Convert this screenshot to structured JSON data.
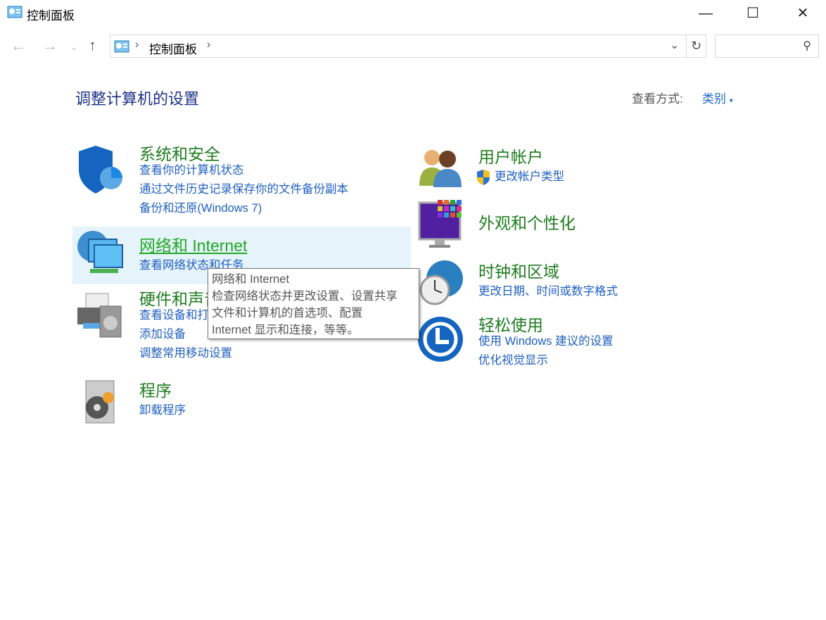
{
  "window": {
    "title": "控制面板"
  },
  "address": {
    "breadcrumb": "控制面板",
    "search_placeholder": ""
  },
  "header": {
    "title": "调整计算机的设置",
    "view_by_label": "查看方式:",
    "view_by_value": "类别"
  },
  "categories": [
    {
      "title": "系统和安全",
      "links": [
        "查看你的计算机状态",
        "通过文件历史记录保存你的文件备份副本",
        "备份和还原(Windows 7)"
      ]
    },
    {
      "title": "网络和 Internet",
      "links": [
        "查看网络状态和任务"
      ]
    },
    {
      "title": "硬件和声音",
      "links": [
        "查看设备和打印机",
        "添加设备",
        "调整常用移动设置"
      ]
    },
    {
      "title": "程序",
      "links": [
        "卸载程序"
      ]
    },
    {
      "title": "用户帐户",
      "links": [
        "更改帐户类型"
      ]
    },
    {
      "title": "外观和个性化",
      "links": []
    },
    {
      "title": "时钟和区域",
      "links": [
        "更改日期、时间或数字格式"
      ]
    },
    {
      "title": "轻松使用",
      "links": [
        "使用 Windows 建议的设置",
        "优化视觉显示"
      ]
    }
  ],
  "tooltip": {
    "title": "网络和 Internet",
    "lines": [
      "检查网络状态并更改设置、设置共享",
      "文件和计算机的首选项、配置",
      "Internet 显示和连接，等等。"
    ]
  }
}
